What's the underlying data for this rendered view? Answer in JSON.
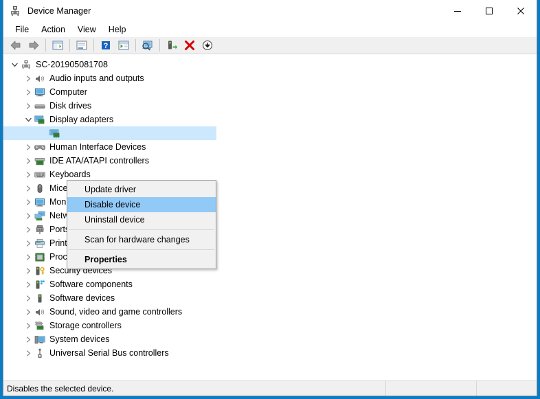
{
  "window": {
    "title": "Device Manager",
    "title_icon": "device-manager-icon",
    "accent_color": "#0a7bc4",
    "caption": {
      "minimize": "minimize-icon",
      "maximize": "maximize-icon",
      "close": "close-icon"
    }
  },
  "menubar": {
    "items": [
      {
        "label": "File"
      },
      {
        "label": "Action"
      },
      {
        "label": "View"
      },
      {
        "label": "Help"
      }
    ]
  },
  "toolbar": {
    "buttons": [
      {
        "name": "back-icon",
        "title": "Back"
      },
      {
        "name": "forward-icon",
        "title": "Forward"
      },
      {
        "name": "separator"
      },
      {
        "name": "show-hide-console-tree-icon",
        "title": "Show/Hide Console Tree"
      },
      {
        "name": "separator"
      },
      {
        "name": "properties-icon",
        "title": "Properties"
      },
      {
        "name": "separator"
      },
      {
        "name": "help-icon",
        "title": "Help"
      },
      {
        "name": "list-view-icon",
        "title": "View"
      },
      {
        "name": "separator"
      },
      {
        "name": "scan-for-hardware-changes-icon",
        "title": "Scan for hardware changes"
      },
      {
        "name": "separator"
      },
      {
        "name": "update-driver-icon",
        "title": "Update driver"
      },
      {
        "name": "uninstall-device-icon",
        "title": "Uninstall device"
      },
      {
        "name": "disable-device-icon",
        "title": "Disable device"
      }
    ]
  },
  "tree": {
    "root": {
      "label": "SC-201905081708",
      "icon": "computer-root-icon",
      "expanded": true
    },
    "nodes": [
      {
        "label": "Audio inputs and outputs",
        "icon": "audio-icon",
        "expanded": false,
        "indent": 1
      },
      {
        "label": "Computer",
        "icon": "computer-icon",
        "expanded": false,
        "indent": 1
      },
      {
        "label": "Disk drives",
        "icon": "disk-drive-icon",
        "expanded": false,
        "indent": 1
      },
      {
        "label": "Display adapters",
        "icon": "display-adapter-icon",
        "expanded": true,
        "indent": 1
      },
      {
        "label": "",
        "icon": "display-adapter-child-icon",
        "expanded": null,
        "indent": 2,
        "selected": true
      },
      {
        "label": "Human Interface Devices",
        "icon": "hid-icon",
        "expanded": false,
        "indent": 1,
        "occluded": true
      },
      {
        "label": "IDE ATA/ATAPI controllers",
        "icon": "ide-controller-icon",
        "expanded": false,
        "indent": 1,
        "occluded": true
      },
      {
        "label": "Keyboards",
        "icon": "keyboard-icon",
        "expanded": false,
        "indent": 1,
        "occluded": true
      },
      {
        "label": "Mice and other pointing devices",
        "icon": "mouse-icon",
        "expanded": false,
        "indent": 1,
        "occluded": true
      },
      {
        "label": "Monitors",
        "icon": "monitor-icon",
        "expanded": false,
        "indent": 1,
        "occluded": true
      },
      {
        "label": "Network adapters",
        "icon": "network-adapter-icon",
        "expanded": false,
        "indent": 1,
        "occluded": true
      },
      {
        "label": "Ports (COM & LPT)",
        "icon": "port-icon",
        "expanded": false,
        "indent": 1,
        "occluded": true
      },
      {
        "label": "Print queues",
        "icon": "printer-icon",
        "expanded": false,
        "indent": 1
      },
      {
        "label": "Processors",
        "icon": "processor-icon",
        "expanded": false,
        "indent": 1
      },
      {
        "label": "Security devices",
        "icon": "security-device-icon",
        "expanded": false,
        "indent": 1
      },
      {
        "label": "Software components",
        "icon": "software-component-icon",
        "expanded": false,
        "indent": 1
      },
      {
        "label": "Software devices",
        "icon": "software-device-icon",
        "expanded": false,
        "indent": 1
      },
      {
        "label": "Sound, video and game controllers",
        "icon": "sound-controller-icon",
        "expanded": false,
        "indent": 1
      },
      {
        "label": "Storage controllers",
        "icon": "storage-controller-icon",
        "expanded": false,
        "indent": 1
      },
      {
        "label": "System devices",
        "icon": "system-device-icon",
        "expanded": false,
        "indent": 1
      },
      {
        "label": "Universal Serial Bus controllers",
        "icon": "usb-controller-icon",
        "expanded": false,
        "indent": 1
      }
    ]
  },
  "context_menu": {
    "highlight_color": "#91c9f7",
    "items": [
      {
        "label": "Update driver",
        "type": "item"
      },
      {
        "label": "Disable device",
        "type": "item",
        "highlighted": true
      },
      {
        "label": "Uninstall device",
        "type": "item"
      },
      {
        "type": "separator"
      },
      {
        "label": "Scan for hardware changes",
        "type": "item"
      },
      {
        "type": "separator"
      },
      {
        "label": "Properties",
        "type": "item",
        "bold": true
      }
    ]
  },
  "statusbar": {
    "message": "Disables the selected device.",
    "panel2": "",
    "panel3": ""
  }
}
